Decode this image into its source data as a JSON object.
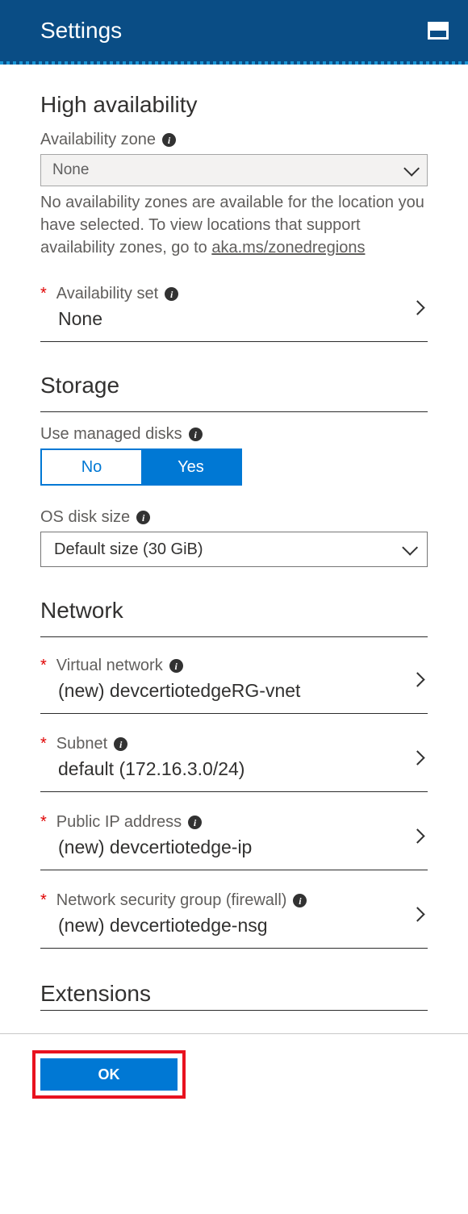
{
  "header": {
    "title": "Settings"
  },
  "high_availability": {
    "heading": "High availability",
    "zone_label": "Availability zone",
    "zone_value": "None",
    "zone_help_a": "No availability zones are available for the location you have selected. To view locations that support availability zones, go to ",
    "zone_help_link": "aka.ms/zonedregions",
    "set_label": "Availability set",
    "set_value": "None"
  },
  "storage": {
    "heading": "Storage",
    "managed_label": "Use managed disks",
    "toggle_no": "No",
    "toggle_yes": "Yes",
    "osdisk_label": "OS disk size",
    "osdisk_value": "Default size (30 GiB)"
  },
  "network": {
    "heading": "Network",
    "vnet_label": "Virtual network",
    "vnet_value": "(new) devcertiotedgeRG-vnet",
    "subnet_label": "Subnet",
    "subnet_value": "default (172.16.3.0/24)",
    "pip_label": "Public IP address",
    "pip_value": "(new) devcertiotedge-ip",
    "nsg_label": "Network security group (firewall)",
    "nsg_value": "(new) devcertiotedge-nsg"
  },
  "extensions": {
    "heading": "Extensions"
  },
  "footer": {
    "ok": "OK"
  }
}
